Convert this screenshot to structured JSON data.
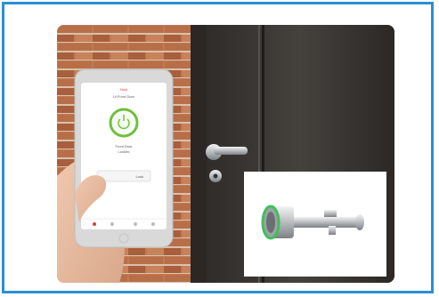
{
  "photo": {
    "alt": "",
    "phone_app": {
      "brand_text": "",
      "subtitle_text": "",
      "status_text": "",
      "status_sub_text": "",
      "lock_button_text": ""
    },
    "colors": {
      "frame_border": "#2a8fd4",
      "app_ring": "#6fbf3a",
      "lock_ring": "#3fbf5a",
      "brick": "#b36a43",
      "door": "#3d3a37"
    }
  }
}
